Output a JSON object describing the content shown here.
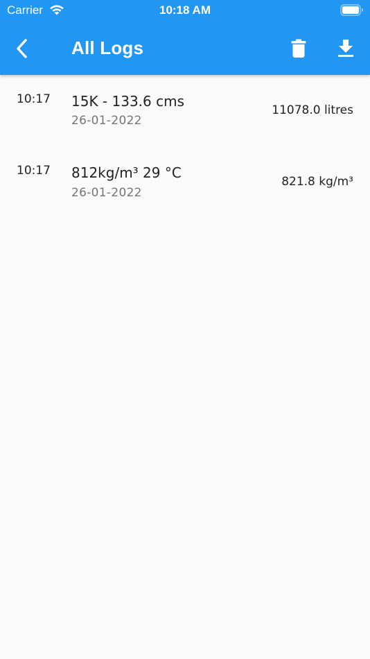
{
  "status_bar": {
    "carrier": "Carrier",
    "time": "10:18 AM",
    "wifi_icon": "wifi-icon",
    "battery_icon": "battery-icon"
  },
  "header": {
    "title": "All Logs",
    "back_icon": "chevron-left-icon",
    "delete_icon": "trash-icon",
    "download_icon": "download-icon",
    "background_color": "#2196f3"
  },
  "logs": [
    {
      "time": "10:17",
      "title": "15K - 133.6 cms",
      "date": "26-01-2022",
      "value": "11078.0 litres"
    },
    {
      "time": "10:17",
      "title": "812kg/m³ 29 °C",
      "date": "26-01-2022",
      "value": "821.8 kg/m³"
    }
  ]
}
